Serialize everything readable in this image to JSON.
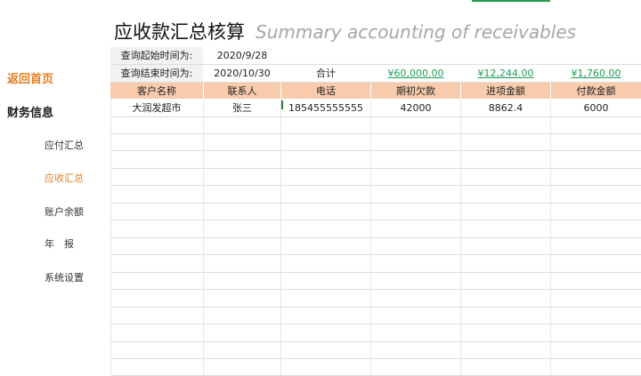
{
  "sidebar": {
    "home": "返回首页",
    "section": "财务信息",
    "items": [
      "应付汇总",
      "应收汇总",
      "账户余额",
      "年　报",
      "系统设置"
    ]
  },
  "header": {
    "title": "应收款汇总核算",
    "subtitle": "Summary accounting of receivables"
  },
  "query": {
    "start_label": "查询起始时间为:",
    "start_value": "2020/9/28",
    "end_label": "查询结束时间为:",
    "end_value": "2020/10/30",
    "total_label": "合计",
    "totals": [
      "¥60,000.00",
      "¥12,244.00",
      "¥1,760.00"
    ]
  },
  "table": {
    "columns": [
      "客户名称",
      "联系人",
      "电话",
      "期初欠款",
      "进项金额",
      "付款金额"
    ],
    "rows": [
      [
        "大润发超市",
        "张三",
        "185455555555",
        "42000",
        "8862.4",
        "6000"
      ]
    ]
  },
  "colors": {
    "accent": "#e67e22",
    "header_bg": "#f8cbad",
    "money": "#1f9d55"
  }
}
